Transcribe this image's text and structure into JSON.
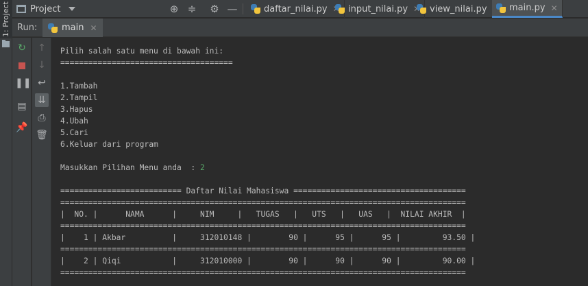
{
  "left_strip": {
    "label": "1: Project"
  },
  "topbar": {
    "project_label": "Project",
    "tabs": [
      {
        "label": "daftar_nilai.py"
      },
      {
        "label": "input_nilai.py"
      },
      {
        "label": "view_nilai.py"
      },
      {
        "label": "main.py"
      }
    ]
  },
  "run": {
    "label": "Run:",
    "tab_label": "main"
  },
  "console": {
    "lines": [
      "Pilih salah satu menu di bawah ini:",
      "=====================================",
      "",
      "1.Tambah",
      "2.Tampil",
      "3.Hapus",
      "4.Ubah",
      "5.Cari",
      "6.Keluar dari program",
      "",
      "Masukkan Pilihan Menu anda  : ",
      "",
      "========================== Daftar Nilai Mahasiswa =====================================",
      "=======================================================================================",
      "|  NO. |      NAMA      |     NIM     |   TUGAS   |   UTS   |   UAS   |  NILAI AKHIR  |",
      "=======================================================================================",
      "|    1 | Akbar          |     312010148 |        90 |      95 |      95 |         93.50 |",
      "=======================================================================================",
      "|    2 | Qiqi           |     312010000 |        90 |      90 |      90 |         90.00 |",
      "======================================================================================="
    ],
    "user_input": "2"
  }
}
